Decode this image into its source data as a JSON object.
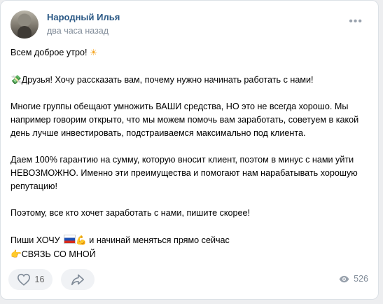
{
  "post": {
    "author": "Народный Илья",
    "time": "два часа назад",
    "more_label": "•••",
    "lines": {
      "greeting": "Всем доброе утро! ",
      "intro": "Друзья! Хочу рассказать вам, почему нужно начинать работать с нами!",
      "para1": "Многие группы обещают умножить ВАШИ средства, НО это не всегда хорошо. Мы например говорим открыто, что мы можем помочь вам заработать, советуем в какой день лучше инвестировать, подстраиваемся максимально под клиента.",
      "para2": "Даем 100% гарантию на сумму, которую вносит клиент, поэтом в минус с нами уйти НЕВОЗМОЖНО. Именно эти преимущества и помогают нам нарабатывать хорошую репутацию!",
      "para3": "Поэтому, все кто хочет заработать с нами, пишите скорее!",
      "cta_prefix": "Пиши ХОЧУ ",
      "cta_suffix": " и начинай меняться прямо сейчас",
      "contact": "СВЯЗЬ СО МНОЙ"
    },
    "icons": {
      "sun": "sun-emoji-icon",
      "money": "money-with-wings-emoji-icon",
      "flag": "russia-flag-emoji-icon",
      "arm": "flexed-biceps-emoji-icon",
      "point": "pointing-hand-emoji-icon"
    }
  },
  "footer": {
    "likes": "16",
    "views": "526"
  },
  "colors": {
    "author": "#2a5885",
    "secondary": "#818c99",
    "button_bg": "#f0f2f5",
    "page_bg": "#edeef0"
  }
}
